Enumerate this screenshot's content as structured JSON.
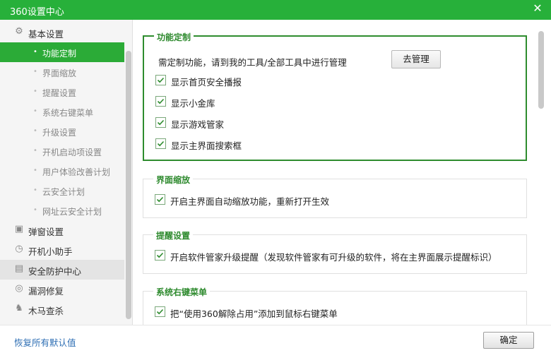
{
  "window": {
    "title": "360设置中心",
    "close_icon": "close-icon"
  },
  "sidebar": {
    "categories": [
      {
        "label": "基本设置",
        "icon": "gear-icon"
      },
      {
        "label": "弹窗设置",
        "icon": "popup-icon"
      },
      {
        "label": "开机小助手",
        "icon": "timer-icon"
      },
      {
        "label": "安全防护中心",
        "icon": "shield-icon"
      },
      {
        "label": "漏洞修复",
        "icon": "patch-icon"
      },
      {
        "label": "木马查杀",
        "icon": "trojan-icon"
      }
    ],
    "basic_items": [
      {
        "label": "功能定制",
        "selected": true
      },
      {
        "label": "界面缩放"
      },
      {
        "label": "提醒设置"
      },
      {
        "label": "系统右键菜单"
      },
      {
        "label": "升级设置"
      },
      {
        "label": "开机启动项设置"
      },
      {
        "label": "用户体验改善计划"
      },
      {
        "label": "云安全计划"
      },
      {
        "label": "网址云安全计划"
      }
    ]
  },
  "sections": {
    "customize": {
      "title": "功能定制",
      "description": "需定制功能，请到我的工具/全部工具中进行管理",
      "manage_button": "去管理",
      "options": [
        {
          "label": "显示首页安全播报",
          "checked": true
        },
        {
          "label": "显示小金库",
          "checked": true
        },
        {
          "label": "显示游戏管家",
          "checked": true
        },
        {
          "label": "显示主界面搜索框",
          "checked": true
        }
      ]
    },
    "zoom": {
      "title": "界面缩放",
      "options": [
        {
          "label": "开启主界面自动缩放功能，重新打开生效",
          "checked": true
        }
      ]
    },
    "reminder": {
      "title": "提醒设置",
      "options": [
        {
          "label": "开启软件管家升级提醒（发现软件管家有可升级的软件，将在主界面展示提醒标识）",
          "checked": true
        }
      ]
    },
    "context_menu": {
      "title": "系统右键菜单",
      "options": [
        {
          "label": "把“使用360解除占用”添加到鼠标右键菜单",
          "checked": true
        }
      ]
    }
  },
  "footer": {
    "restore_label": "恢复所有默认值",
    "ok_label": "确定"
  },
  "colors": {
    "accent": "#27b03a",
    "selected_nav": "#2bab37",
    "section_title": "#2e8a2e",
    "link": "#2f6fb4"
  }
}
